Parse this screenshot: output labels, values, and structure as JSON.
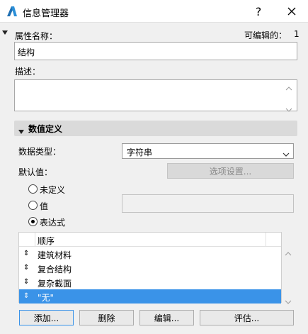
{
  "window": {
    "title": "信息管理器",
    "help_icon": "help-icon",
    "close_icon": "close-icon"
  },
  "property": {
    "name_label": "属性名称：",
    "editable_label": "可编辑的：",
    "editable_count": "1",
    "name_value": "结构",
    "description_label": "描述："
  },
  "value_definition": {
    "section_title": "数值定义",
    "data_type_label": "数据类型：",
    "data_type_value": "字符串",
    "default_label": "默认值：",
    "options_button": "选项设置...",
    "radio_undefined": "未定义",
    "radio_value": "值",
    "radio_expression": "表达式",
    "selected_radio": "表达式"
  },
  "list": {
    "header": "顺序",
    "items": [
      "建筑材料",
      "复合结构",
      "复杂截面",
      "\"无\""
    ],
    "selected_index": 3
  },
  "buttons": {
    "add": "添加...",
    "delete": "删除",
    "edit": "编辑...",
    "evaluate": "评估..."
  },
  "colors": {
    "selection": "#3a93e8",
    "section_bg": "#dadada",
    "dialog_bg": "#f0f0f0"
  }
}
